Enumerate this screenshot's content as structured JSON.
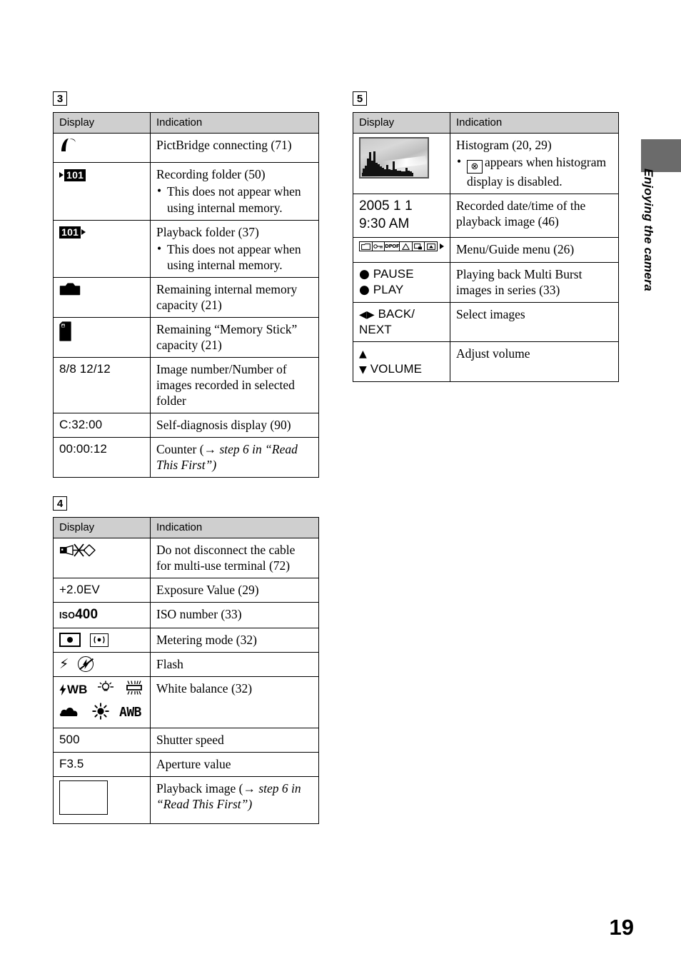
{
  "page": {
    "number": "19",
    "side_tab_label": "Enjoying the camera"
  },
  "columns": {
    "headers": {
      "display": "Display",
      "indication": "Indication"
    }
  },
  "tables": [
    {
      "marker": "3",
      "rows": [
        {
          "display_icon": "pictbridge-icon",
          "display_text": "",
          "indication": "PictBridge connecting (71)",
          "note": ""
        },
        {
          "display_icon": "recording-folder-icon",
          "display_text": "",
          "indication": "Recording folder (50)",
          "note": "This does not appear when using internal memory."
        },
        {
          "display_icon": "playback-folder-icon",
          "display_text": "",
          "indication": "Playback folder (37)",
          "note": "This does not appear when using internal memory."
        },
        {
          "display_icon": "internal-memory-icon",
          "display_text": "",
          "indication": "Remaining internal memory capacity (21)",
          "note": ""
        },
        {
          "display_icon": "memory-stick-icon",
          "display_text": "",
          "indication": "Remaining “Memory Stick” capacity (21)",
          "note": ""
        },
        {
          "display_icon": "",
          "display_text": "8/8 12/12",
          "indication": "Image number/Number of images recorded in selected folder",
          "note": ""
        },
        {
          "display_icon": "",
          "display_text": "C:32:00",
          "indication": "Self-diagnosis display (90)",
          "note": ""
        },
        {
          "display_icon": "",
          "display_text": "00:00:12",
          "indication_prefix": "Counter (",
          "indication_arrow": "→",
          "indication_italic": " step 6 in “Read This First”",
          "indication_suffix": ")",
          "indication": "",
          "note": ""
        }
      ]
    },
    {
      "marker": "4",
      "rows": [
        {
          "display_icon": "do-not-disconnect-cable-icon",
          "display_text": "",
          "indication": "Do not disconnect the cable for multi-use terminal (72)",
          "note": ""
        },
        {
          "display_icon": "",
          "display_text": "+2.0EV",
          "indication": "Exposure Value (29)",
          "note": ""
        },
        {
          "display_icon": "iso-number-icon",
          "display_text": "ISO400",
          "iso_small": "ISO",
          "iso_value": "400",
          "indication": "ISO number (33)",
          "note": ""
        },
        {
          "display_icon": "metering-mode-icons",
          "display_text": "",
          "indication": "Metering mode (32)",
          "note": ""
        },
        {
          "display_icon": "flash-icons",
          "display_text": "",
          "indication": "Flash",
          "note": ""
        },
        {
          "display_icon": "white-balance-icons",
          "display_text": "",
          "wb_label": "WB",
          "wb_awb": "AWB",
          "indication": "White balance (32)",
          "note": ""
        },
        {
          "display_icon": "",
          "display_text": "500",
          "indication": "Shutter speed",
          "note": ""
        },
        {
          "display_icon": "",
          "display_text": "F3.5",
          "indication": "Aperture value",
          "note": ""
        },
        {
          "display_icon": "playback-image-frame-icon",
          "display_text": "",
          "indication_prefix": "Playback image (",
          "indication_arrow": "→",
          "indication_italic": " step 6 in “Read This First”",
          "indication_suffix": ")",
          "indication": "",
          "note": ""
        }
      ]
    },
    {
      "marker": "5",
      "rows": [
        {
          "display_icon": "histogram-thumbnail-icon",
          "display_text": "",
          "indication": "Histogram (20, 29)",
          "note_icon": "histogram-disabled-icon",
          "note": "appears when histogram display is disabled."
        },
        {
          "display_icon": "",
          "display_text": "2005 1 1\n9:30 AM",
          "display_line1": "2005 1 1",
          "display_line2": "9:30 AM",
          "indication": "Recorded date/time of the playback image (46)",
          "note": ""
        },
        {
          "display_icon": "menu-guide-strip-icon",
          "display_text": "",
          "indication": "Menu/Guide menu (26)",
          "note": ""
        },
        {
          "display_icon": "multiburst-pause-play-icon",
          "display_text": "",
          "display_line1": "PAUSE",
          "display_line2": "PLAY",
          "indication": "Playing back Multi Burst images in series (33)",
          "note": ""
        },
        {
          "display_icon": "back-next-icon",
          "display_text": "",
          "display_line1": "BACK/",
          "display_line2": "NEXT",
          "indication": "Select images",
          "note": ""
        },
        {
          "display_icon": "volume-icon",
          "display_text": "",
          "display_line1": "VOLUME",
          "indication": "Adjust volume",
          "note": ""
        }
      ]
    }
  ],
  "colors": {
    "header_bg": "#cfcfcf",
    "side_tab": "#6b6b6b",
    "rule": "#000000"
  }
}
